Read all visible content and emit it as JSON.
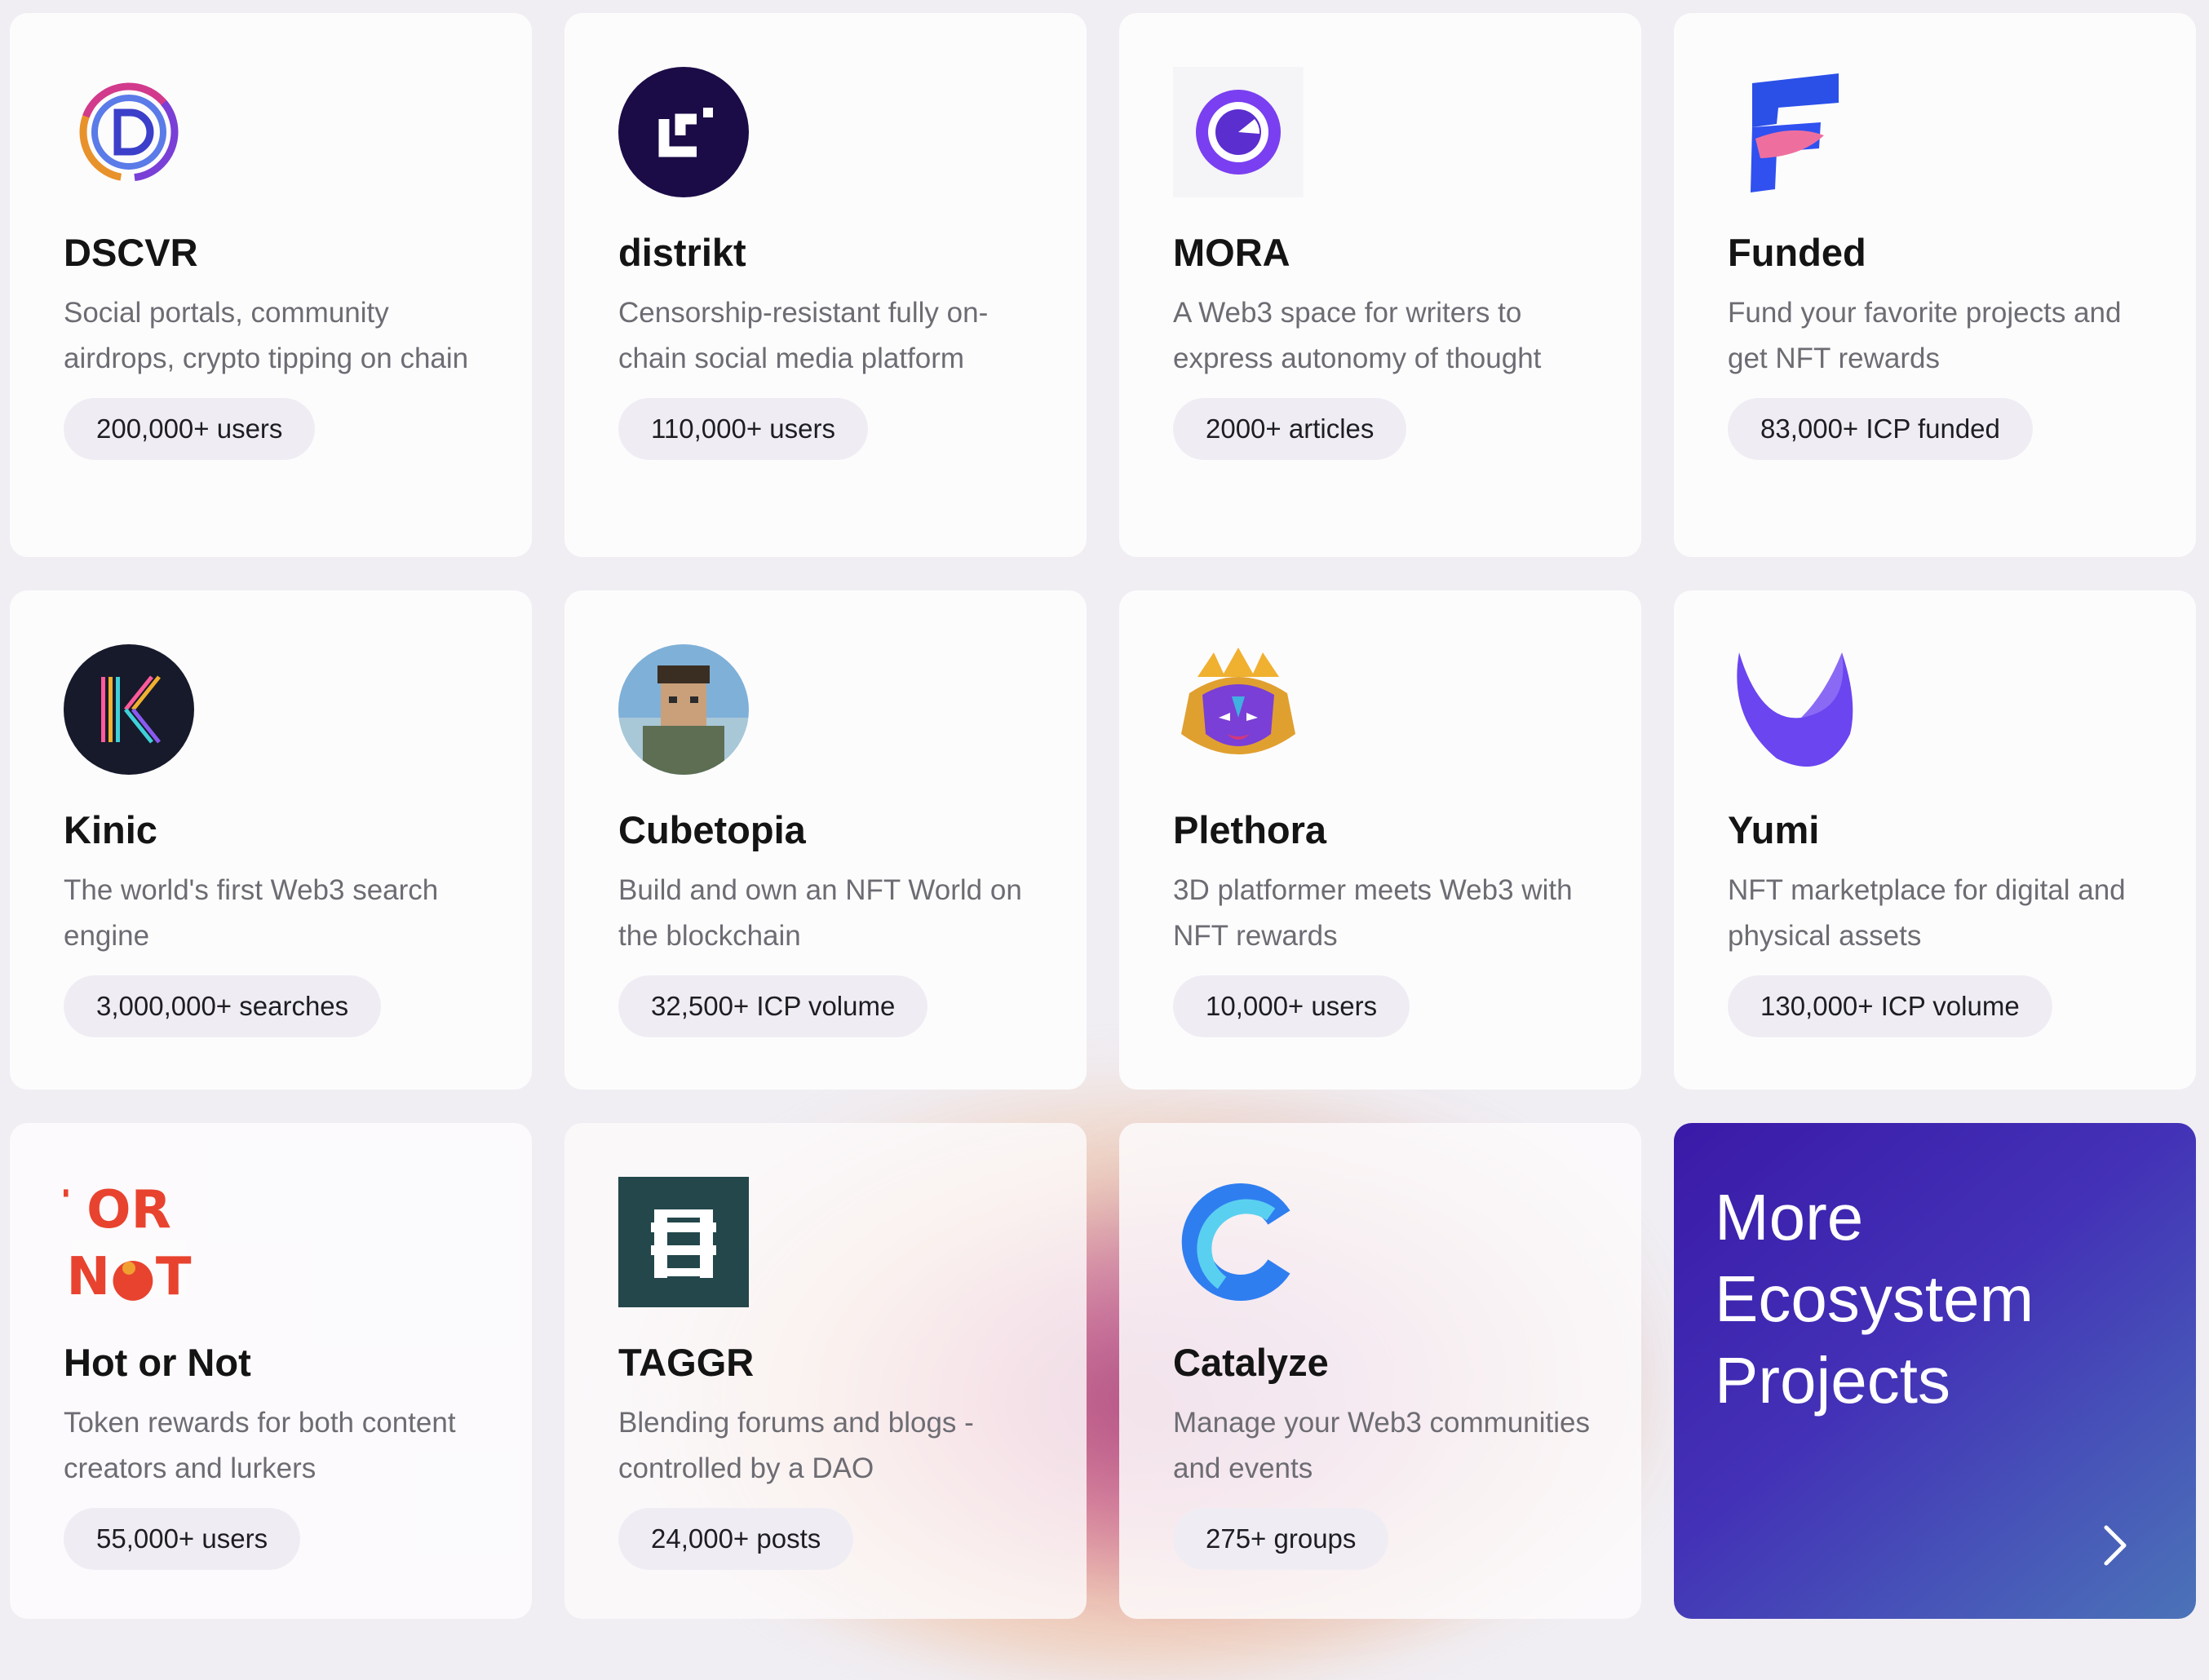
{
  "cards": [
    {
      "name": "DSCVR",
      "desc": "Social portals, community airdrops, crypto tipping on chain",
      "stat": "200,000+ users",
      "logo_icon": "dscvr-logo-icon"
    },
    {
      "name": "distrikt",
      "desc": "Censorship-resistant fully on-chain social media platform",
      "stat": "110,000+ users",
      "logo_icon": "distrikt-logo-icon"
    },
    {
      "name": "MORA",
      "desc": "A Web3 space for writers to express autonomy of thought",
      "stat": "2000+ articles",
      "logo_icon": "mora-logo-icon"
    },
    {
      "name": "Funded",
      "desc": "Fund your favorite projects and get NFT rewards",
      "stat": "83,000+ ICP funded",
      "logo_icon": "funded-logo-icon"
    },
    {
      "name": "Kinic",
      "desc": "The world's first Web3 search engine",
      "stat": "3,000,000+ searches",
      "logo_icon": "kinic-logo-icon"
    },
    {
      "name": "Cubetopia",
      "desc": "Build and own an NFT World on the blockchain",
      "stat": "32,500+ ICP volume",
      "logo_icon": "cubetopia-logo-icon"
    },
    {
      "name": "Plethora",
      "desc": "3D platformer meets Web3 with NFT rewards",
      "stat": "10,000+ users",
      "logo_icon": "plethora-logo-icon"
    },
    {
      "name": "Yumi",
      "desc": "NFT marketplace for digital and physical assets",
      "stat": "130,000+ ICP volume",
      "logo_icon": "yumi-logo-icon"
    },
    {
      "name": "Hot or Not",
      "desc": "Token rewards for both content creators and lurkers",
      "stat": "55,000+ users",
      "logo_icon": "hot-or-not-logo-icon"
    },
    {
      "name": "TAGGR",
      "desc": "Blending forums and blogs - controlled by a DAO",
      "stat": "24,000+ posts",
      "logo_icon": "taggr-logo-icon"
    },
    {
      "name": "Catalyze",
      "desc": "Manage your Web3 communities and events",
      "stat": "275+ groups",
      "logo_icon": "catalyze-logo-icon"
    }
  ],
  "more": {
    "title": "More Ecosystem Projects",
    "arrow_icon": "chevron-right-icon"
  },
  "logo_text": {
    "hot_or_not": "HOT OR NOT"
  },
  "colors": {
    "more_gradient_start": "#3a1aa8",
    "more_gradient_end": "#4b73b8",
    "pill_bg": "#efedf3"
  }
}
